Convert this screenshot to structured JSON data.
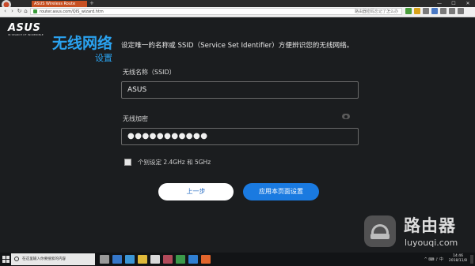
{
  "browser": {
    "tab_title": "ASUS Wireless Route",
    "new_tab": "+",
    "window_controls": [
      "—",
      "☐",
      "✕"
    ],
    "url": "router.asus.com/QIS_wizard.htm",
    "url_right": "路由器密码忘记了怎么办",
    "nav": [
      "‹",
      "›",
      "↻",
      "⌂"
    ]
  },
  "page": {
    "logo": "ASUS",
    "logo_tagline": "IN SEARCH OF INCREDIBLE",
    "heading_line1": "无线网络",
    "heading_line2": "设置",
    "description": "设定唯一的名称或 SSID（Service Set Identifier）方便辨识您的无线网络。",
    "ssid_label": "无线名称（SSID）",
    "ssid_value": "ASUS",
    "key_label": "无线加密",
    "key_value": "●●●●●●●●●●●",
    "separate_label": "个别设定 2.4GHz 和 5GHz",
    "prev_button": "上一步",
    "apply_button": "应用本页面设置"
  },
  "watermark": {
    "title": "路由器",
    "url": "luyouqi.com"
  },
  "taskbar": {
    "search_placeholder": "在这里输入你要搜索的内容",
    "time": "14:46",
    "date": "2018/11/8",
    "tray": "^ ⌨ ♪ 中"
  }
}
